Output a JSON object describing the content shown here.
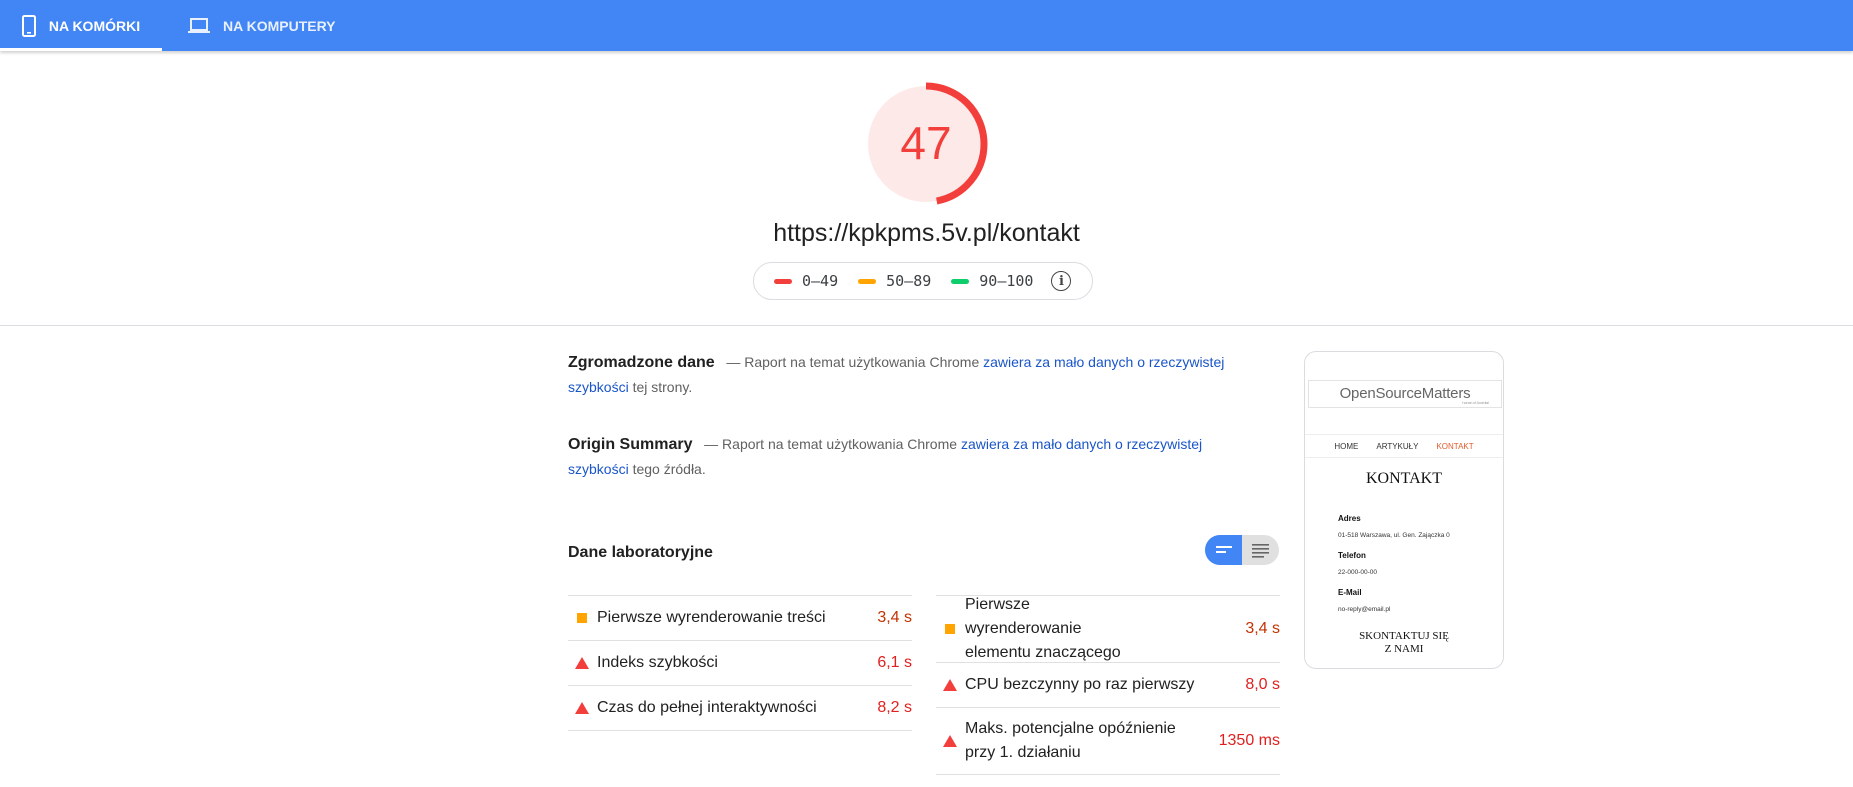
{
  "tabs": [
    {
      "label": "NA KOMÓRKI",
      "icon": "smartphone-icon",
      "active": true
    },
    {
      "label": "NA KOMPUTERY",
      "icon": "laptop-icon",
      "active": false
    }
  ],
  "score": {
    "value": "47",
    "fraction": 0.47,
    "color": "#f33f3c"
  },
  "url": "https://kpkpms.5v.pl/kontakt",
  "legend": [
    {
      "range": "0–49",
      "color": "#f33f3c"
    },
    {
      "range": "50–89",
      "color": "#ffa400"
    },
    {
      "range": "90–100",
      "color": "#0cce6b"
    }
  ],
  "field_data": {
    "title": "Zgromadzone dane",
    "dash": "—",
    "prefix": "Raport na temat użytkowania Chrome",
    "link_a": "zawiera za mało danych o rzeczywistej",
    "link_b": "szybkości",
    "suffix": "tej strony."
  },
  "origin_summary": {
    "title": "Origin Summary",
    "dash": "—",
    "prefix": "Raport na temat użytkowania Chrome",
    "link_a": "zawiera za mało danych o rzeczywistej",
    "link_b": "szybkości",
    "suffix": "tego źródła."
  },
  "lab": {
    "title": "Dane laboratoryjne",
    "left": [
      {
        "label": "Pierwsze wyrenderowanie treści",
        "value": "3,4 s",
        "status": "average"
      },
      {
        "label": "Indeks szybkości",
        "value": "6,1 s",
        "status": "fail"
      },
      {
        "label": "Czas do pełnej interaktywności",
        "value": "8,2 s",
        "status": "fail"
      }
    ],
    "right": [
      {
        "label": "Pierwsze wyrenderowanie elementu znaczącego",
        "value": "3,4 s",
        "status": "average"
      },
      {
        "label": "CPU bezczynny po raz pierwszy",
        "value": "8,0 s",
        "status": "fail"
      },
      {
        "label": "Maks. potencjalne opóźnienie przy 1. działaniu",
        "value": "1350 ms",
        "status": "fail"
      }
    ]
  },
  "screenshot": {
    "logo": "OpenSourceMatters",
    "logo_sub": "home of Joomla!",
    "nav": [
      "HOME",
      "ARTYKUŁY",
      "KONTAKT"
    ],
    "title": "KONTAKT",
    "address_label": "Adres",
    "address": "01-518 Warszawa, ul. Gen. Zajączka 0",
    "phone_label": "Telefon",
    "phone": "22-000-00-00",
    "email_label": "E-Mail",
    "email": "no-reply@email.pl",
    "button": "SKONTAKTUJ SIĘ Z NAMI"
  }
}
